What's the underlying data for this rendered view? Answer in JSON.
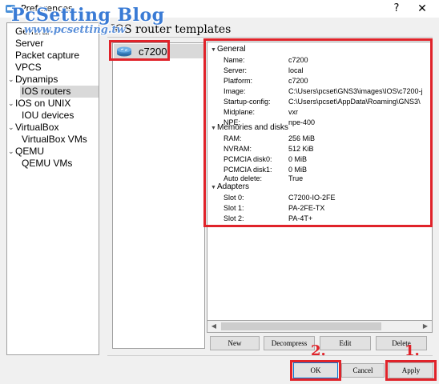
{
  "window": {
    "title": "Preferences",
    "help": "?",
    "close": "✕"
  },
  "watermark": {
    "brand": "PcSetting Blog",
    "url": "www.pcsetting.tw"
  },
  "sidebar": {
    "items": [
      {
        "label": "General"
      },
      {
        "label": "Server"
      },
      {
        "label": "Packet capture"
      },
      {
        "label": "VPCS"
      },
      {
        "label": "Dynamips",
        "expander": "⌄"
      },
      {
        "label": "IOS routers"
      },
      {
        "label": "IOS on UNIX",
        "expander": "⌄"
      },
      {
        "label": "IOU devices"
      },
      {
        "label": "VirtualBox",
        "expander": "⌄"
      },
      {
        "label": "VirtualBox VMs"
      },
      {
        "label": "QEMU",
        "expander": "⌄"
      },
      {
        "label": "QEMU VMs"
      }
    ]
  },
  "main": {
    "title": "IOS router templates",
    "templates": [
      {
        "name": "c7200",
        "icon": "router-icon"
      }
    ],
    "details": {
      "groups": [
        {
          "label": "General",
          "caret": "▼",
          "props": [
            {
              "key": "Name:",
              "value": "c7200"
            },
            {
              "key": "Server:",
              "value": "local"
            },
            {
              "key": "Platform:",
              "value": "c7200"
            },
            {
              "key": "Image:",
              "value": "C:\\Users\\pcset\\GNS3\\images\\IOS\\c7200-j"
            },
            {
              "key": "Startup-config:",
              "value": "C:\\Users\\pcset\\AppData\\Roaming\\GNS3\\"
            },
            {
              "key": "Midplane:",
              "value": "vxr"
            },
            {
              "key": "NPE:",
              "value": "npe-400"
            }
          ]
        },
        {
          "label": "Memories and disks",
          "caret": "▼",
          "props": [
            {
              "key": "RAM:",
              "value": "256 MiB"
            },
            {
              "key": "NVRAM:",
              "value": "512 KiB"
            },
            {
              "key": "PCMCIA disk0:",
              "value": "0 MiB"
            },
            {
              "key": "PCMCIA disk1:",
              "value": "0 MiB"
            },
            {
              "key": "Auto delete:",
              "value": "True"
            }
          ]
        },
        {
          "label": "Adapters",
          "caret": "▼",
          "props": [
            {
              "key": "Slot 0:",
              "value": "C7200-IO-2FE"
            },
            {
              "key": "Slot 1:",
              "value": "PA-2FE-TX"
            },
            {
              "key": "Slot 2:",
              "value": "PA-4T+"
            }
          ]
        }
      ]
    },
    "scroll": {
      "left": "◀",
      "right": "▶"
    },
    "actions": {
      "new": "New",
      "decompress": "Decompress",
      "edit": "Edit",
      "delete": "Delete"
    }
  },
  "footer": {
    "ok": "OK",
    "cancel": "Cancel",
    "apply": "Apply"
  },
  "annotations": {
    "step1": "1.",
    "step2": "2."
  },
  "colors": {
    "highlight": "#e0232a",
    "watermark": "#3a7bd5",
    "selection": "#d9d9d9"
  }
}
